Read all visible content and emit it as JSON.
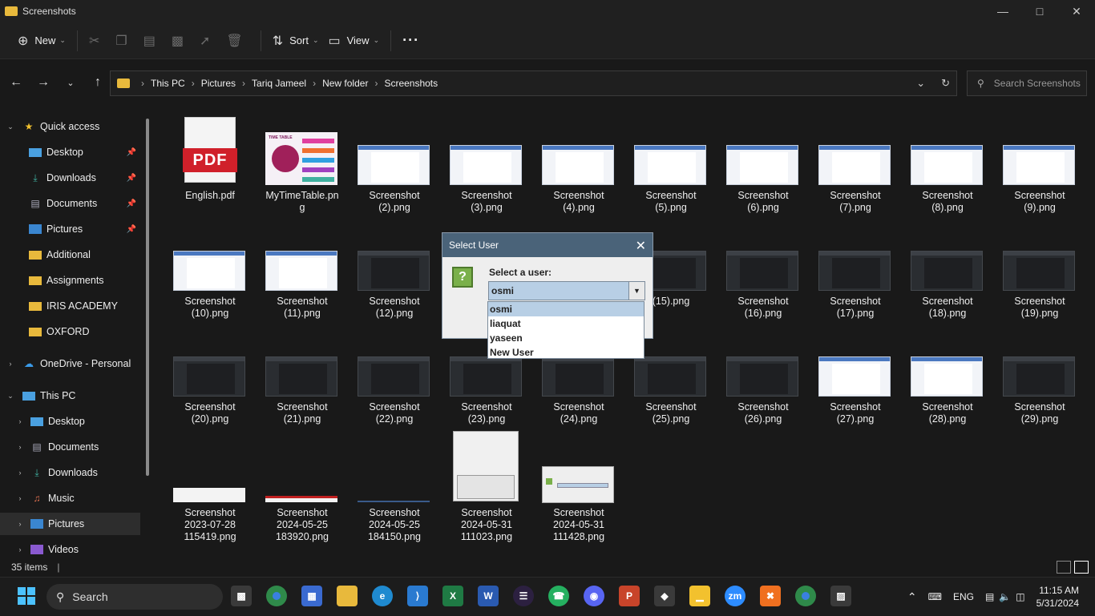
{
  "window": {
    "title": "Screenshots"
  },
  "toolbar": {
    "new_label": "New",
    "sort_label": "Sort",
    "view_label": "View",
    "more_label": "···"
  },
  "address": {
    "crumbs": [
      "This PC",
      "Pictures",
      "Tariq Jameel",
      "New folder",
      "Screenshots"
    ],
    "search_placeholder": "Search Screenshots"
  },
  "sidebar": {
    "items": [
      {
        "label": "Quick access"
      },
      {
        "label": "Desktop"
      },
      {
        "label": "Downloads"
      },
      {
        "label": "Documents"
      },
      {
        "label": "Pictures"
      },
      {
        "label": "Additional"
      },
      {
        "label": "Assignments"
      },
      {
        "label": "IRIS ACADEMY"
      },
      {
        "label": "OXFORD"
      },
      {
        "label": "OneDrive - Personal"
      },
      {
        "label": "This PC"
      },
      {
        "label": "Desktop"
      },
      {
        "label": "Documents"
      },
      {
        "label": "Downloads"
      },
      {
        "label": "Music"
      },
      {
        "label": "Pictures"
      },
      {
        "label": "Videos"
      }
    ]
  },
  "files": [
    {
      "l1": "English.pdf",
      "l2": "",
      "l3": ""
    },
    {
      "l1": "MyTimeTable.pn",
      "l2": "g",
      "l3": ""
    },
    {
      "l1": "Screenshot",
      "l2": "(2).png",
      "l3": ""
    },
    {
      "l1": "Screenshot",
      "l2": "(3).png",
      "l3": ""
    },
    {
      "l1": "Screenshot",
      "l2": "(4).png",
      "l3": ""
    },
    {
      "l1": "Screenshot",
      "l2": "(5).png",
      "l3": ""
    },
    {
      "l1": "Screenshot",
      "l2": "(6).png",
      "l3": ""
    },
    {
      "l1": "Screenshot",
      "l2": "(7).png",
      "l3": ""
    },
    {
      "l1": "Screenshot",
      "l2": "(8).png",
      "l3": ""
    },
    {
      "l1": "Screenshot",
      "l2": "(9).png",
      "l3": ""
    },
    {
      "l1": "Screenshot",
      "l2": "(10).png",
      "l3": ""
    },
    {
      "l1": "Screenshot",
      "l2": "(11).png",
      "l3": ""
    },
    {
      "l1": "Screenshot",
      "l2": "(12).png",
      "l3": ""
    },
    {
      "l1": "",
      "l2": "",
      "l3": ""
    },
    {
      "l1": "",
      "l2": "(15).png",
      "l3": ""
    },
    {
      "l1": "Screenshot",
      "l2": "(16).png",
      "l3": ""
    },
    {
      "l1": "Screenshot",
      "l2": "(17).png",
      "l3": ""
    },
    {
      "l1": "Screenshot",
      "l2": "(18).png",
      "l3": ""
    },
    {
      "l1": "Screenshot",
      "l2": "(19).png",
      "l3": ""
    },
    {
      "l1": "Screenshot",
      "l2": "(20).png",
      "l3": ""
    },
    {
      "l1": "Screenshot",
      "l2": "(21).png",
      "l3": ""
    },
    {
      "l1": "Screenshot",
      "l2": "(22).png",
      "l3": ""
    },
    {
      "l1": "Screenshot",
      "l2": "(23).png",
      "l3": ""
    },
    {
      "l1": "Screenshot",
      "l2": "(24).png",
      "l3": ""
    },
    {
      "l1": "Screenshot",
      "l2": "(25).png",
      "l3": ""
    },
    {
      "l1": "Screenshot",
      "l2": "(26).png",
      "l3": ""
    },
    {
      "l1": "Screenshot",
      "l2": "(27).png",
      "l3": ""
    },
    {
      "l1": "Screenshot",
      "l2": "(28).png",
      "l3": ""
    },
    {
      "l1": "Screenshot",
      "l2": "(29).png",
      "l3": ""
    },
    {
      "l1": "Screenshot",
      "l2": "2023-07-28",
      "l3": "115419.png"
    },
    {
      "l1": "Screenshot",
      "l2": "2024-05-25",
      "l3": "183920.png"
    },
    {
      "l1": "Screenshot",
      "l2": "2024-05-25",
      "l3": "184150.png"
    },
    {
      "l1": "Screenshot",
      "l2": "2024-05-31",
      "l3": "111023.png"
    },
    {
      "l1": "Screenshot",
      "l2": "2024-05-31",
      "l3": "111428.png"
    }
  ],
  "thumbs": {
    "pdf_label": "PDF",
    "timetable_label": "TIME TABLE"
  },
  "dialog": {
    "title": "Select User",
    "prompt": "Select a user:",
    "selected": "osmi",
    "options": [
      "osmi",
      "liaquat",
      "yaseen",
      "New User"
    ]
  },
  "status": {
    "count": "35 items"
  },
  "taskbar": {
    "search_label": "Search",
    "lang": "ENG",
    "time": "11:15 AM",
    "date": "5/31/2024"
  },
  "colors": {
    "accent": "#4a6379",
    "folder": "#e8b93c",
    "selection": "#b8cfe5"
  }
}
